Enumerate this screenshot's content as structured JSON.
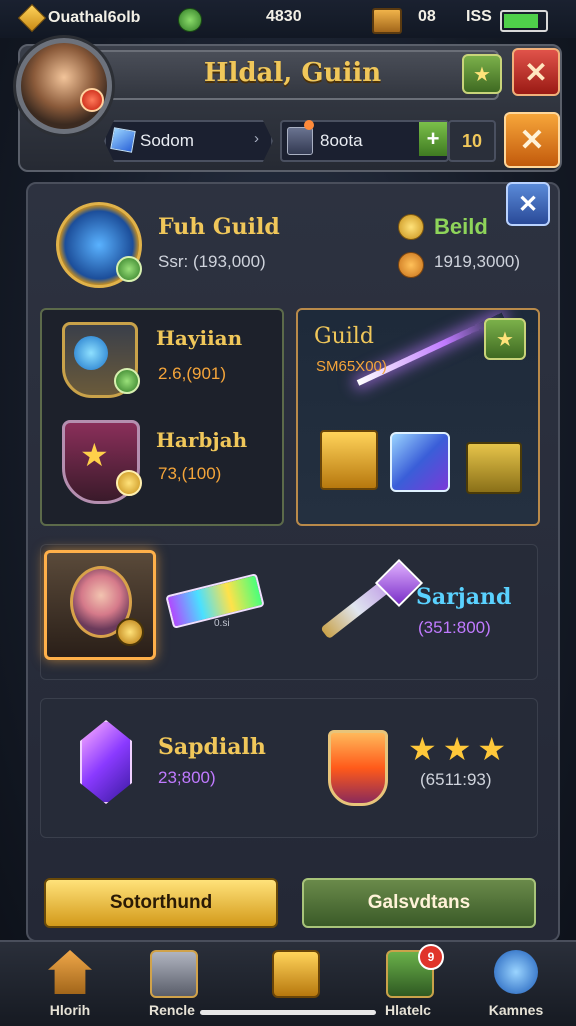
{
  "status_bar": {
    "app_label": "Ouathal6olb",
    "center_value": "4830",
    "right_value": "08",
    "network": "ISS"
  },
  "header": {
    "title": "Hldal, Guiin",
    "search_label": "Sodom",
    "boost_label": "8oota",
    "count": "10"
  },
  "guild": {
    "name": "Fuh Guild",
    "stat": "Ssr:  (193,000)",
    "build_label": "Beild",
    "build_value": "1919,3000)"
  },
  "members": [
    {
      "name": "Hayiian",
      "value": "2.6,(901)"
    },
    {
      "name": "Harbjah",
      "value": "73,(100)"
    }
  ],
  "guild_card": {
    "title": "Guild",
    "value": "SM65X00)"
  },
  "row3": {
    "bar_caption": "0.si",
    "name": "Sarjand",
    "value": "(351:800)"
  },
  "row4": {
    "name": "Sapdialh",
    "value": "23;800)",
    "stars": "★★★",
    "score": "(6511:93)"
  },
  "actions": {
    "primary": "Sotorthund",
    "secondary": "Galsvdtans"
  },
  "nav": [
    {
      "label": "Hlorih",
      "icon": "home-icon",
      "badge": ""
    },
    {
      "label": "Rencle",
      "icon": "forge-icon",
      "badge": ""
    },
    {
      "label": "",
      "icon": "chest-icon",
      "badge": ""
    },
    {
      "label": "Hlatelc",
      "icon": "map-icon",
      "badge": "9"
    },
    {
      "label": "Kamnes",
      "icon": "orb-icon",
      "badge": ""
    }
  ],
  "colors": {
    "gold_text": "#f0c75a",
    "green_text": "#8ed45a",
    "purple_text": "#c07aff",
    "cyan_text": "#5ad2ff"
  }
}
